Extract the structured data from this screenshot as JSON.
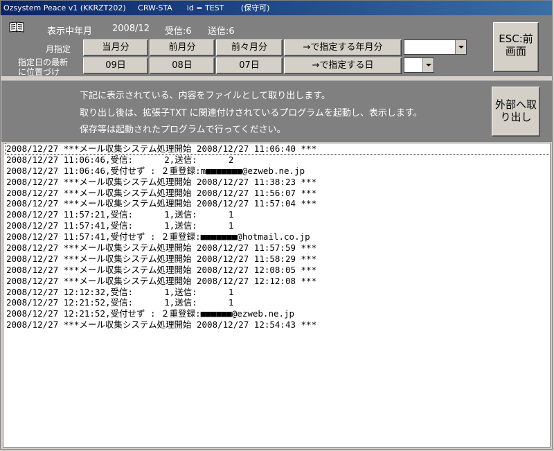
{
  "title": "Ozsystem Peace v1 (KKRZT202)     CRW-STA      id = TEST       (保守可)",
  "header": {
    "book_icon": "book-icon",
    "display_label": "表示中年月",
    "year_month": "2008/12",
    "received": "受信:6",
    "sent": "送信:6"
  },
  "month_row": {
    "label": "月指定",
    "this_month": "当月分",
    "last_month": "前月分",
    "two_months_ago": "前々月分",
    "specify_month": "→で指定する年月分",
    "month_combo_value": ""
  },
  "day_row": {
    "label_line1": "指定日の最新",
    "label_line2": "に位置づけ",
    "day1": "09日",
    "day2": "08日",
    "day3": "07日",
    "specify_day": "→で指定する日",
    "day_combo_value": ""
  },
  "esc_button": "ESC:前画面",
  "export": {
    "line1": "下記に表示されている、内容をファイルとして取り出します。",
    "line2": "取り出し後は、拡張子TXT に関連付けされているプログラムを起動し、表示します。",
    "line3": "保存等は起動されたプログラムで行ってください。",
    "button": "外部へ取り出し"
  },
  "log_lines": [
    "2008/12/27 ***メール収集システム処理開始 2008/12/27 11:06:40 ***",
    "2008/12/27 11:06:46,受信:      2,送信:      2",
    "2008/12/27 11:06:46,受付せず : ２重登録:m■■■■■■■@ezweb.ne.jp",
    "2008/12/27 ***メール収集システム処理開始 2008/12/27 11:38:23 ***",
    "2008/12/27 ***メール収集システム処理開始 2008/12/27 11:56:07 ***",
    "2008/12/27 ***メール収集システム処理開始 2008/12/27 11:57:04 ***",
    "2008/12/27 11:57:21,受信:      1,送信:      1",
    "2008/12/27 11:57:41,受信:      1,送信:      1",
    "2008/12/27 11:57:41,受付せず : ２重登録:■■■■■■■@hotmail.co.jp",
    "2008/12/27 ***メール収集システム処理開始 2008/12/27 11:57:59 ***",
    "2008/12/27 ***メール収集システム処理開始 2008/12/27 11:58:29 ***",
    "2008/12/27 ***メール収集システム処理開始 2008/12/27 12:08:05 ***",
    "2008/12/27 ***メール収集システム処理開始 2008/12/27 12:12:08 ***",
    "2008/12/27 12:12:32,受信:      1,送信:      1",
    "2008/12/27 12:21:52,受信:      1,送信:      1",
    "2008/12/27 12:21:52,受付せず : ２重登録:■■■■■■@ezweb.ne.jp",
    "2008/12/27 ***メール収集システム処理開始 2008/12/27 12:54:43 ***"
  ]
}
